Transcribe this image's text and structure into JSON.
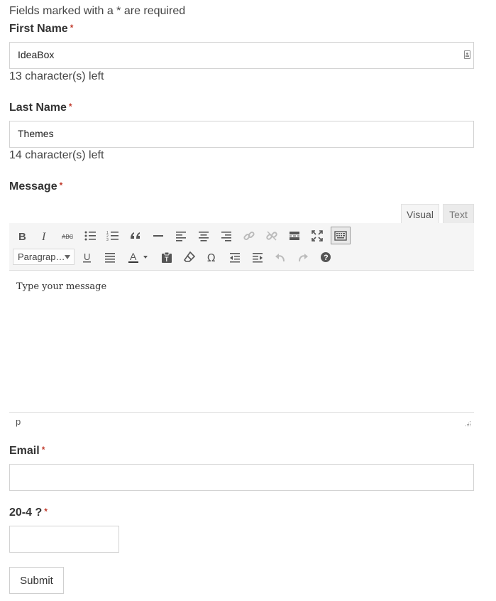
{
  "form": {
    "required_note": "Fields marked with a * are required",
    "required_star": "*",
    "first_name": {
      "label": "First Name",
      "value": "IdeaBox",
      "counter": "13 character(s) left"
    },
    "last_name": {
      "label": "Last Name",
      "value": "Themes",
      "counter": "14 character(s) left"
    },
    "message": {
      "label": "Message",
      "tabs": {
        "visual": "Visual",
        "text": "Text"
      },
      "format_select": "Paragrap…",
      "placeholder": "Type your message",
      "path": "p"
    },
    "email": {
      "label": "Email",
      "value": ""
    },
    "captcha": {
      "label": "20-4 ?",
      "value": ""
    },
    "submit_label": "Submit"
  },
  "toolbar_icons": {
    "row1": [
      "bold-icon",
      "italic-icon",
      "strikethrough-icon",
      "bullet-list-icon",
      "numbered-list-icon",
      "blockquote-icon",
      "horizontal-line-icon",
      "align-left-icon",
      "align-center-icon",
      "align-right-icon",
      "link-icon",
      "unlink-icon",
      "read-more-icon",
      "fullscreen-icon",
      "toolbar-toggle-icon"
    ],
    "row2": [
      "underline-icon",
      "justify-icon",
      "text-color-icon",
      "paste-text-icon",
      "clear-format-icon",
      "special-character-icon",
      "outdent-icon",
      "indent-icon",
      "undo-icon",
      "redo-icon",
      "help-icon"
    ]
  },
  "colors": {
    "required": "#c0392b",
    "border": "#d3d3d3",
    "toolbar_bg": "#f5f5f5"
  }
}
